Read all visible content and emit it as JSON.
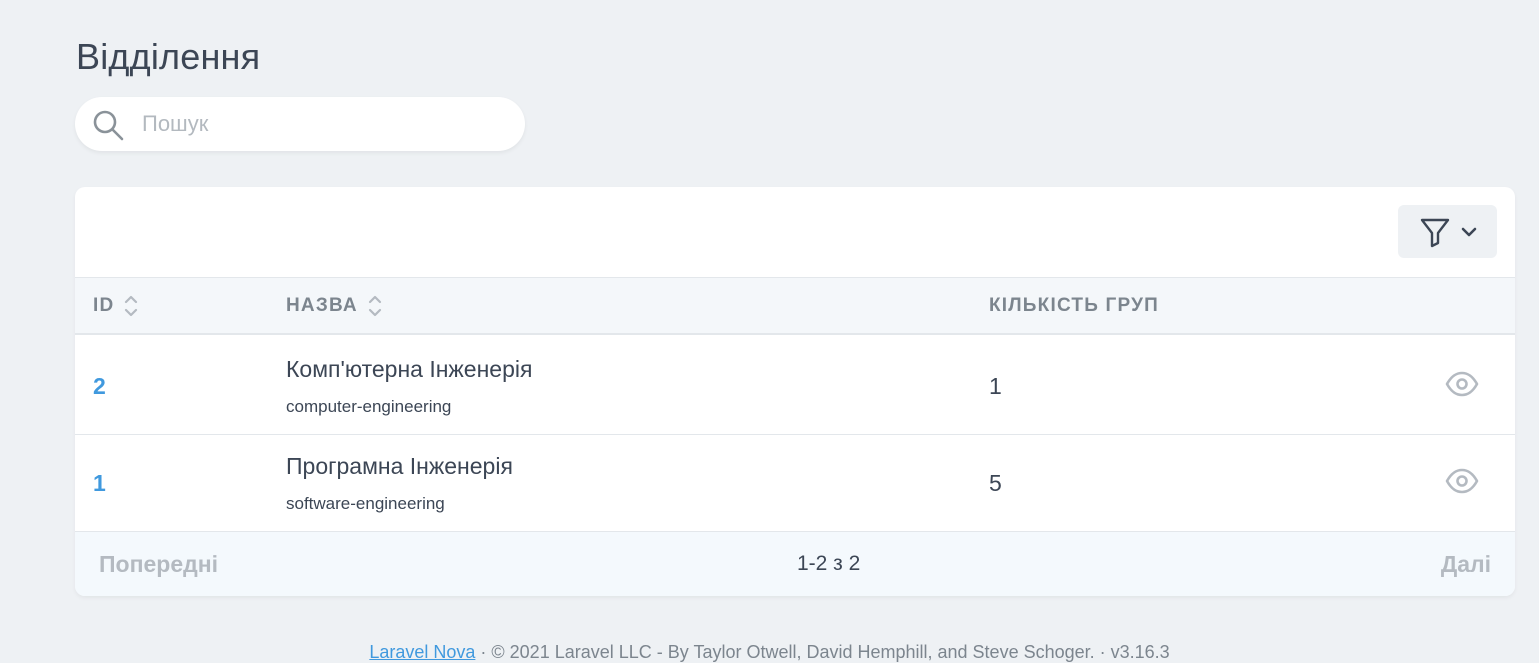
{
  "page": {
    "title": "Відділення"
  },
  "search": {
    "placeholder": "Пошук"
  },
  "table": {
    "columns": [
      {
        "label": "ID",
        "sortable": true
      },
      {
        "label": "Назва",
        "sortable": true
      },
      {
        "label": "Кількість груп",
        "sortable": false
      }
    ],
    "rows": [
      {
        "id": "2",
        "name": "Комп'ютерна Інженерія",
        "slug": "computer-engineering",
        "count": "1"
      },
      {
        "id": "1",
        "name": "Програмна Інженерія",
        "slug": "software-engineering",
        "count": "5"
      }
    ]
  },
  "pagination": {
    "prev": "Попередні",
    "info": "1-2 з 2",
    "next": "Далі"
  },
  "footer": {
    "link": "Laravel Nova",
    "text": "·  © 2021 Laravel LLC - By Taylor Otwell, David Hemphill, and Steve Schoger.  ·  v3.16.3"
  },
  "icons": {
    "search": "search-icon",
    "filter": "filter-icon",
    "chevron": "chevron-down-icon",
    "sort": "sort-icon",
    "view": "eye-icon"
  },
  "colors": {
    "accent": "#4099de",
    "background": "#eef1f4",
    "text": "#3c4655",
    "muted": "#7c858e"
  }
}
